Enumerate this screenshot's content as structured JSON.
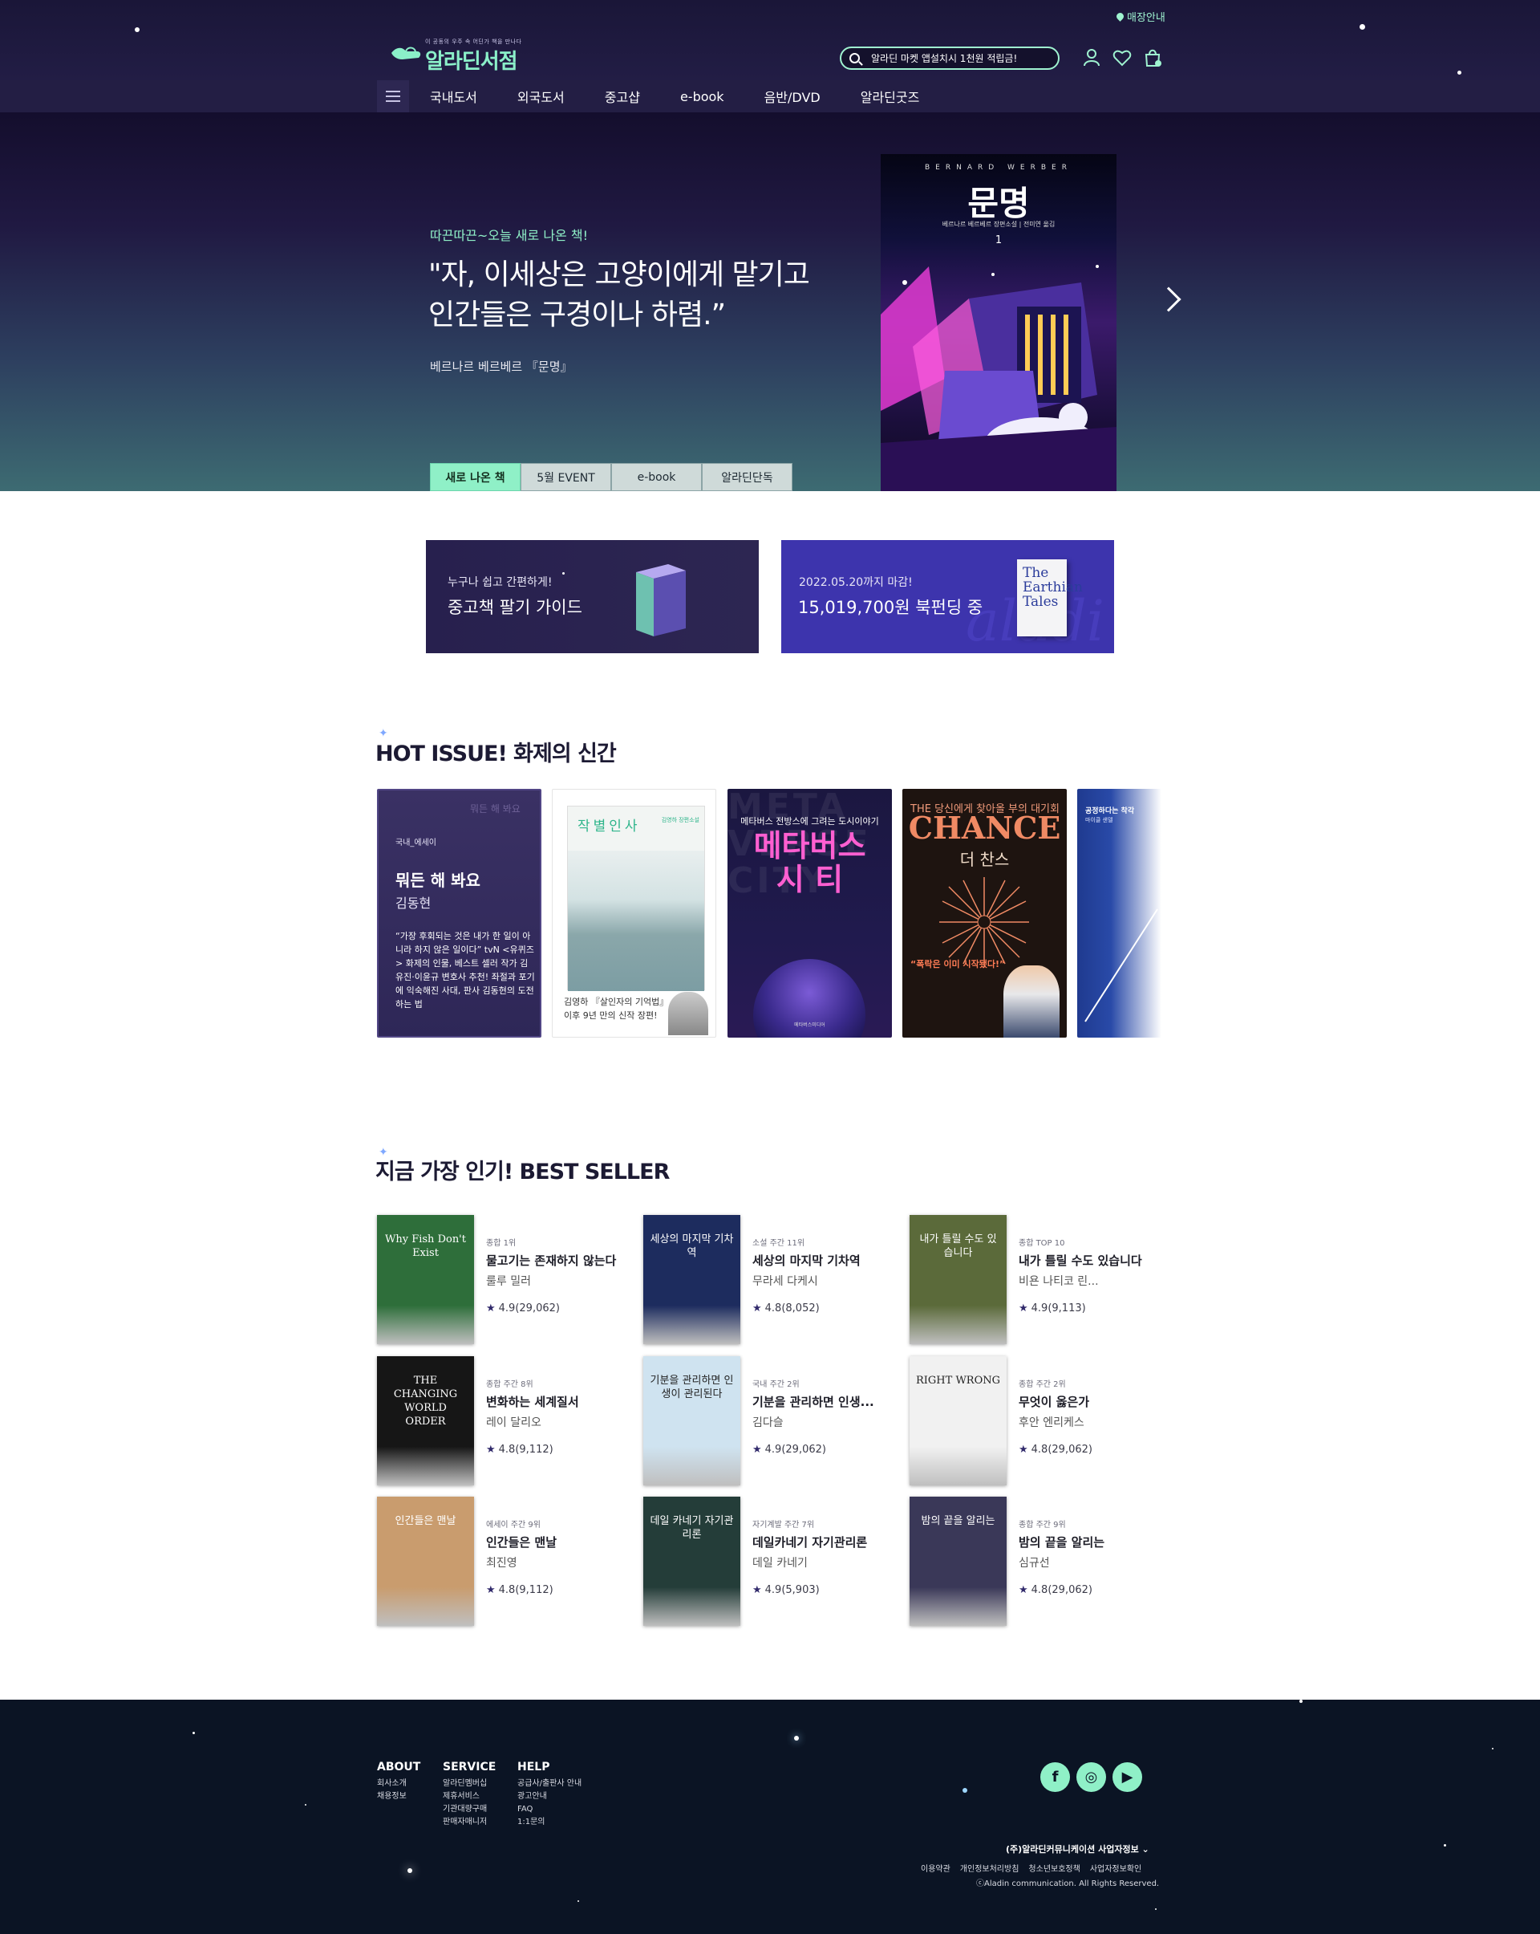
{
  "header": {
    "store_info": "매장안내",
    "logo_tagline": "이 공동의 우주 속 어딘가 책을 만나다",
    "logo_text": "알라딘서점",
    "search_placeholder": "알라딘 마켓 앱설치시 1천원 적립금!",
    "icons": [
      "user-icon",
      "heart-icon",
      "cart-icon"
    ]
  },
  "nav": {
    "items": [
      "국내도서",
      "외국도서",
      "중고샵",
      "e-book",
      "음반/DVD",
      "알라딘굿즈"
    ]
  },
  "hero": {
    "kicker": "따끈따끈~오늘 새로 나온 책!",
    "quote_line1": "\"자, 이세상은 고양이에게 맡기고",
    "quote_line2": "인간들은 구경이나 하렴.”",
    "author": "베르나르 베르베르 『문명』",
    "book": {
      "author_en": "BERNARD WERBER",
      "title": "문명",
      "subtitle": "베르나르 베르베르 장편소설 | 전미연 옮김",
      "volume": "1"
    },
    "tabs": [
      "새로 나온 책",
      "5월 EVENT",
      "e-book",
      "알라딘단독"
    ]
  },
  "banners": [
    {
      "line1": "누구나 쉽고 간편하게!",
      "line2": "중고책 팔기 가이드"
    },
    {
      "line1": "2022.05.20까지 마감!",
      "line2": "15,019,700원 북펀딩 중",
      "book_text": "The Earthian Tales",
      "watermark": "aladi"
    }
  ],
  "hot_issue": {
    "title": "HOT ISSUE! 화제의 신간",
    "card1": {
      "ghost_title": "뭐든 해 봐요",
      "category": "국내_에세이",
      "title": "뭐든 해 봐요",
      "author": "김동현",
      "desc": "“가장 후회되는 것은 내가 한 일이 아니라 하지 않은 일이다” tvN <유퀴즈> 화제의 인물, 베스트 셀러 작가 김유진·이윤규 변호사 추천! 좌절과 포기에 익숙해진 사대, 판사 김동현의 도전하는 법"
    },
    "card2": {
      "cover_title": "작별인사",
      "cover_author": "김영하 장편소설",
      "caption": "김영하 『살인자의 기억법』 이후 9년 만의 신작 장편!"
    },
    "card3": {
      "bg_text": "META VERSE CITY",
      "sub": "메타버스 전방스에 그려는 도시이야기",
      "big1": "메타버스",
      "big2": "시   티",
      "pub": "메타버스미디어"
    },
    "card4": {
      "line1": "THE 당신에게 찾아올 부의 대기회",
      "big": "CHANCE",
      "ko": "더 찬스",
      "quote": "“폭락은 이미 시작됐다!”"
    },
    "card5": {
      "title": "공정하다는 착각",
      "author": "마이클 샌델"
    }
  },
  "best_seller": {
    "title": "지금 가장 인기! BEST SELLER",
    "items": [
      {
        "rank": "종합 1위",
        "title": "물고기는 존재하지 않는다",
        "author": "룰루 밀러",
        "rating": "4.9(29,062)",
        "cover_text": "Why Fish Don't Exist",
        "color": "#2e6e3a"
      },
      {
        "rank": "소설 주간 11위",
        "title": "세상의 마지막 기차역",
        "author": "무라세 다케시",
        "rating": "4.8(8,052)",
        "cover_text": "세상의 마지막 기차역",
        "color": "#1d2c5e"
      },
      {
        "rank": "종합 TOP 10",
        "title": "내가 틀릴 수도 있습니다",
        "author": "비욘 나티코 린...",
        "rating": "4.9(9,113)",
        "cover_text": "내가 틀릴 수도 있습니다",
        "color": "#5b6a3a"
      },
      {
        "rank": "종합 주간 8위",
        "title": "변화하는 세계질서",
        "author": "레이 달리오",
        "rating": "4.8(9,112)",
        "cover_text": "THE CHANGING WORLD ORDER",
        "color": "#161616"
      },
      {
        "rank": "국내 주간 2위",
        "title": "기분을 관리하면 인생...",
        "author": "김다슬",
        "rating": "4.9(29,062)",
        "cover_text": "기분을 관리하면 인생이 관리된다",
        "color": "#cfe3f0"
      },
      {
        "rank": "종합 주간 2위",
        "title": "무엇이 옳은가",
        "author": "후안 엔리케스",
        "rating": "4.8(29,062)",
        "cover_text": "RIGHT WRONG",
        "color": "#f1f1f1"
      },
      {
        "rank": "에세이 주간 9위",
        "title": "인간들은 맨날",
        "author": "최진영",
        "rating": "4.8(9,112)",
        "cover_text": "인간들은 맨날",
        "color": "#c99c6e"
      },
      {
        "rank": "자기계발 주간 7위",
        "title": "데일카네기 자기관리론",
        "author": "데일 카네기",
        "rating": "4.9(5,903)",
        "cover_text": "데일 카네기 자기관리론",
        "color": "#243d39"
      },
      {
        "rank": "종합 주간 9위",
        "title": "밤의 끝을 알리는",
        "author": "심규선",
        "rating": "4.8(29,062)",
        "cover_text": "밤의 끝을 알리는",
        "color": "#3a3858"
      }
    ],
    "rating_star": "★"
  },
  "footer": {
    "about": {
      "title": "ABOUT",
      "links": [
        "회사소개",
        "채용정보"
      ]
    },
    "service": {
      "title": "SERVICE",
      "links": [
        "알라딘멤버십",
        "제휴서비스",
        "기관대량구매",
        "판매자매니저"
      ]
    },
    "help": {
      "title": "HELP",
      "links": [
        "공급사/출판사 안내",
        "광고안내",
        "FAQ",
        "1:1문의"
      ]
    },
    "social": [
      "f",
      "◎",
      "▶"
    ],
    "corp_info": "(주)알라딘커뮤니케이션 사업자정보 ⌄",
    "links": [
      "이용약관",
      "개인정보처리방침",
      "청소년보호정책",
      "사업자정보확인"
    ],
    "copyright": "ⓒAladin communication. All Rights Reserved."
  }
}
